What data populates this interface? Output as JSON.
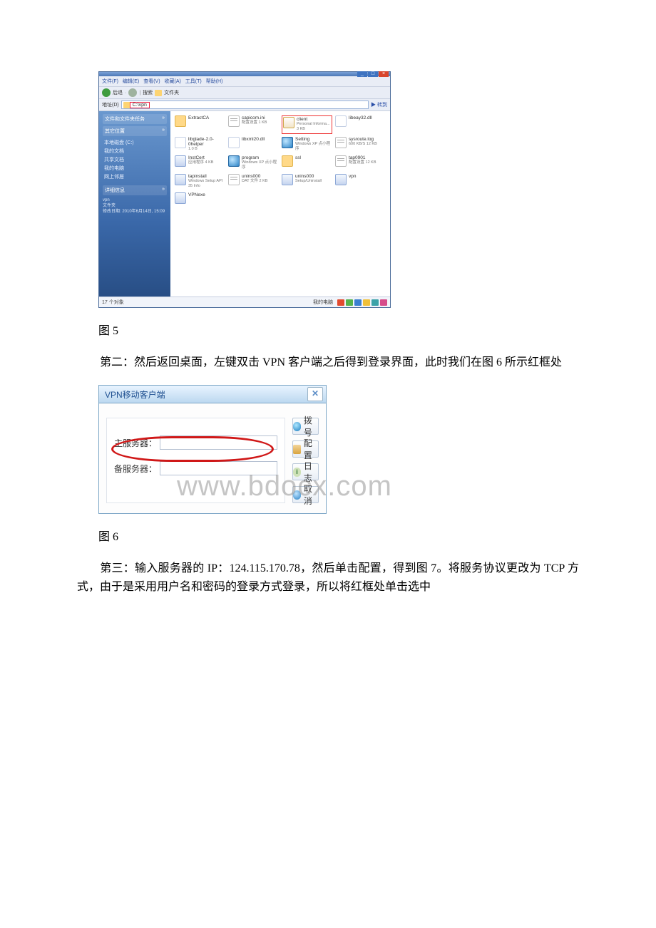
{
  "explorer": {
    "window_buttons": {
      "min": "_",
      "max": "□",
      "close": "×"
    },
    "menu": [
      "文件(F)",
      "编辑(E)",
      "查看(V)",
      "收藏(A)",
      "工具(T)",
      "帮助(H)"
    ],
    "toolbar": {
      "back": "后退",
      "sep": "·",
      "search": "搜索",
      "folders": "文件夹"
    },
    "address": {
      "label": "地址(D)",
      "path": "C:\\vpn",
      "go": "转到"
    },
    "sidebar": {
      "panel1_title": "文件和文件夹任务",
      "arrow": "»",
      "panel2_title": "其它位置",
      "panel2_items": [
        "本地磁盘 (C:)",
        "我的文档",
        "共享文档",
        "我的电脑",
        "网上邻居"
      ],
      "panel3_title": "详细信息",
      "details": [
        "vpn",
        "文件夹",
        "修改日期: 2010年6月14日, 15:09"
      ]
    },
    "files": [
      {
        "n": "ExtractCA",
        "s": "",
        "t": "folder"
      },
      {
        "n": "capicom.ini",
        "s": "配置设置  1 KB",
        "t": "ini"
      },
      {
        "n": "client",
        "s": "Personal Informa...  3 KB",
        "t": "cert",
        "red": true
      },
      {
        "n": "libeay32.dll",
        "s": "",
        "t": "dll"
      },
      {
        "n": "libglade-2.0-0helper",
        "s": "1.0 B",
        "t": "dll"
      },
      {
        "n": "libxml20.dll",
        "s": "",
        "t": "dll"
      },
      {
        "n": "Setting",
        "s": "Windows XP 点小程序",
        "t": "globe"
      },
      {
        "n": "sysroute.log",
        "s": "600  KB/S  12 KB",
        "t": "ini"
      },
      {
        "n": "InstCert",
        "s": "应用程序  4 KB",
        "t": "exe"
      },
      {
        "n": "program",
        "s": "Windows XP 点小程序",
        "t": "globe"
      },
      {
        "n": "ssl",
        "s": "",
        "t": "folder"
      },
      {
        "n": "tap0901",
        "s": "配置设置  12 KB",
        "t": "ini"
      },
      {
        "n": "tapinstall",
        "s": "Windows Setup API  35 Info",
        "t": "exe"
      },
      {
        "n": "unins000",
        "s": "DAT 文件  2 KB",
        "t": "ini"
      },
      {
        "n": "unins000",
        "s": "Setup/Uninstall",
        "t": "exe"
      },
      {
        "n": "vpn",
        "s": "",
        "t": "exe"
      },
      {
        "n": "VPNexe",
        "s": "",
        "t": "exe"
      }
    ],
    "status_left": "17 个对象",
    "status_right": "我的电脑"
  },
  "caption5": "图 5",
  "para2": "第二：然后返回桌面，左键双击 VPN 客户端之后得到登录界面，此时我们在图 6 所示红框处",
  "vpn": {
    "title": "VPN移动客户端",
    "close": "✕",
    "main_label": "主服务器：",
    "backup_label": "备服务器：",
    "main_value": "",
    "backup_value": "",
    "btn_dial": "拨号",
    "btn_conf": "配置",
    "btn_log": "日志",
    "btn_cancel": "取消",
    "log_i": "i"
  },
  "watermark": "www.bdocx.com",
  "caption6": "图 6",
  "para3": "第三：输入服务器的 IP：124.115.170.78，然后单击配置，得到图 7。将服务协议更改为 TCP 方式，由于是采用用户名和密码的登录方式登录，所以将红框处单击选中"
}
